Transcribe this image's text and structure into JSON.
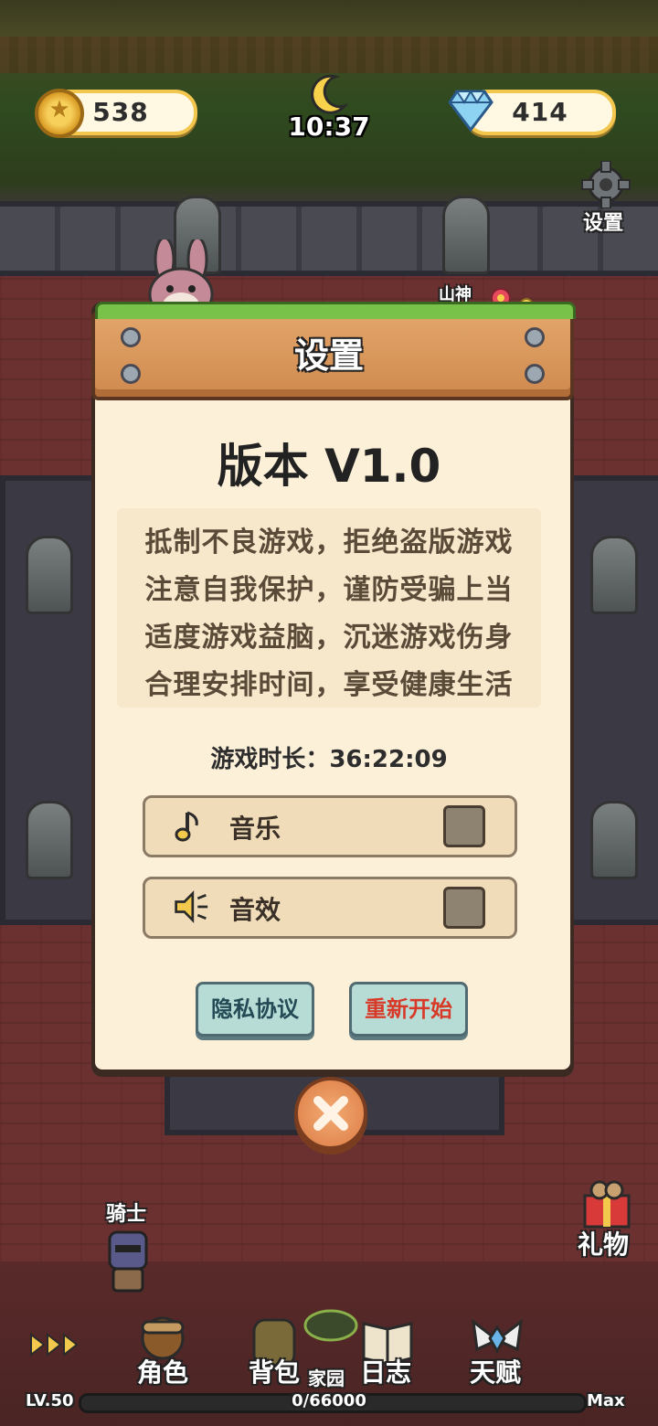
{
  "hud": {
    "coins": "538",
    "gems": "414",
    "time": "10:37",
    "settings_label": "设置"
  },
  "scene": {
    "statue_label": "山神",
    "knight_label": "骑士",
    "gift_label": "礼物"
  },
  "dialog": {
    "title": "设置",
    "version": "版本 V1.0",
    "notice": [
      "抵制不良游戏，拒绝盗版游戏",
      "注意自我保护，谨防受骗上当",
      "适度游戏益脑，沉迷游戏伤身",
      "合理安排时间，享受健康生活"
    ],
    "playtime": "游戏时长：36:22:09",
    "music_label": "音乐",
    "sfx_label": "音效",
    "music_enabled": false,
    "sfx_enabled": false,
    "privacy_button": "隐私协议",
    "restart_button": "重新开始"
  },
  "bottom_nav": {
    "items": [
      "角色",
      "背包",
      "家园",
      "日志",
      "天赋"
    ],
    "level": "LV.50",
    "xp": "0/66000",
    "max": "Max"
  },
  "colors": {
    "coin_border": "#f3c64e",
    "restart_text": "#d83a2a",
    "privacy_text": "#234a55",
    "dialog_bg": "#fdf0d8"
  }
}
